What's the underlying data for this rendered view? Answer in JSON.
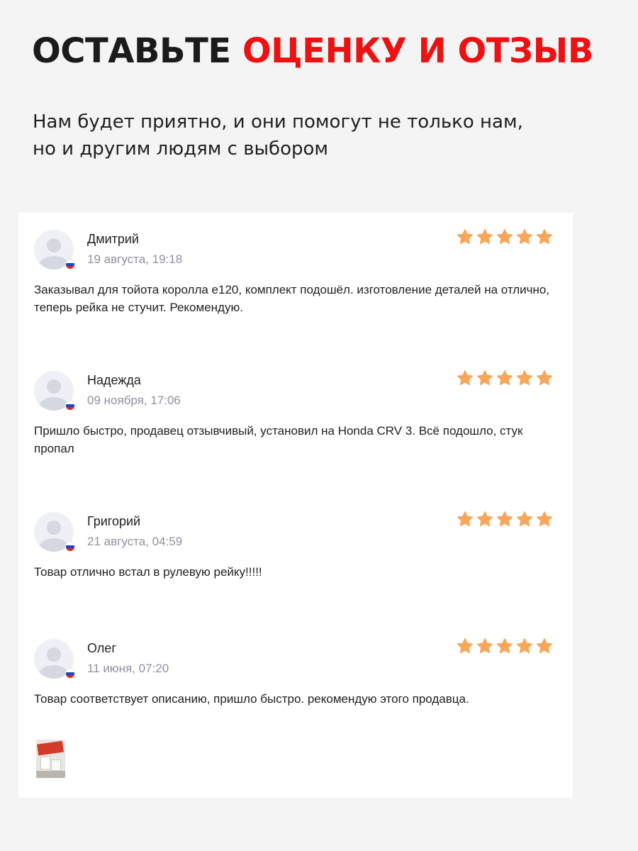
{
  "header": {
    "title_part1": "ОСТАВЬТЕ",
    "title_part2": "ОЦЕНКУ И ОТЗЫВ",
    "subtitle_line1": "Нам будет приятно, и они помогут не только нам,",
    "subtitle_line2": "но и другим людям с выбором"
  },
  "colors": {
    "accent_red": "#ee1111",
    "star": "#f7a65a",
    "page_background": "#f4f4f4",
    "card_background": "#ffffff"
  },
  "reviews": [
    {
      "name": "Дмитрий",
      "date": "19 августа, 19:18",
      "rating": 5,
      "text": "Заказывал для тойота королла е120, комплект подошёл. изготовление деталей на отлично, теперь рейка не стучит. Рекомендую.",
      "avatar_icon": "user-avatar-icon",
      "country_icon": "russia-flag-icon"
    },
    {
      "name": "Надежда",
      "date": "09 ноября, 17:06",
      "rating": 5,
      "text": "Пришло быстро, продавец отзывчивый, установил на Honda CRV 3. Всё подошло, стук пропал",
      "avatar_icon": "user-avatar-icon",
      "country_icon": "russia-flag-icon"
    },
    {
      "name": "Григорий",
      "date": "21 августа, 04:59",
      "rating": 5,
      "text": "Товар отлично встал в рулевую рейку!!!!!",
      "avatar_icon": "user-avatar-icon",
      "country_icon": "russia-flag-icon"
    },
    {
      "name": "Олег",
      "date": "11 июня, 07:20",
      "rating": 5,
      "text": "Товар соответствует описанию, пришло быстро. рекомендую этого продавца.",
      "avatar_icon": "user-avatar-icon",
      "country_icon": "russia-flag-icon"
    }
  ]
}
